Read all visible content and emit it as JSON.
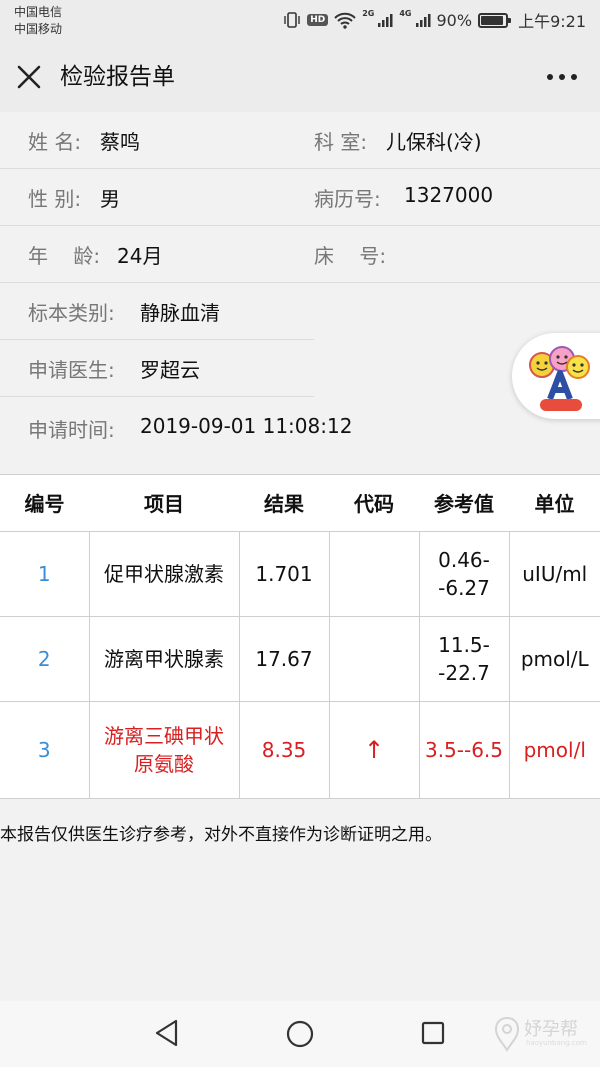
{
  "status_bar": {
    "carrier_1": "中国电信",
    "carrier_2": "中国移动",
    "hd": "HD",
    "net_1": "2G",
    "net_2": "4G",
    "battery_percent": "90%",
    "battery_level": 0.9,
    "time": "上午9:21"
  },
  "header": {
    "title": "检验报告单",
    "close_icon": "close-icon",
    "more_icon": "more-icon"
  },
  "patient": {
    "name_label": "姓 名:",
    "name": "蔡鸣",
    "dept_label": "科 室:",
    "dept": "儿保科(冷)",
    "gender_label": "性 别:",
    "gender": "男",
    "record_label": "病历号:",
    "record_no": "1327000",
    "age_label": "年    龄:",
    "age": "24月",
    "bed_label": "床    号:",
    "bed": "",
    "specimen_label": "标本类别:",
    "specimen": "静脉血清",
    "doctor_label": "申请医生:",
    "doctor": "罗超云",
    "time_label": "申请时间:",
    "time": "2019-09-01 11:08:12"
  },
  "table": {
    "headers": [
      "编号",
      "项目",
      "结果",
      "代码",
      "参考值",
      "单位"
    ],
    "rows": [
      {
        "no": "1",
        "item": "促甲状腺激素",
        "result": "1.701",
        "code": "",
        "ref_1": "0.46-",
        "ref_2": "-6.27",
        "unit": "uIU/ml"
      },
      {
        "no": "2",
        "item": "游离甲状腺素",
        "result": "17.67",
        "code": "",
        "ref_1": "11.5-",
        "ref_2": "-22.7",
        "unit": "pmol/L"
      },
      {
        "no": "3",
        "item_1": "游离三碘甲状",
        "item_2": "原氨酸",
        "result": "8.35",
        "code": "↑",
        "ref": "3.5--6.5",
        "unit": "pmol/l"
      }
    ]
  },
  "disclaimer": "本报告仅供医生诊疗参考，对外不直接作为诊断证明之用。",
  "watermark": {
    "text": "妤孕帮",
    "sub": "haoyunbang.com"
  },
  "colors": {
    "link_blue": "#3b8ed6",
    "alert_red": "#d82020"
  }
}
